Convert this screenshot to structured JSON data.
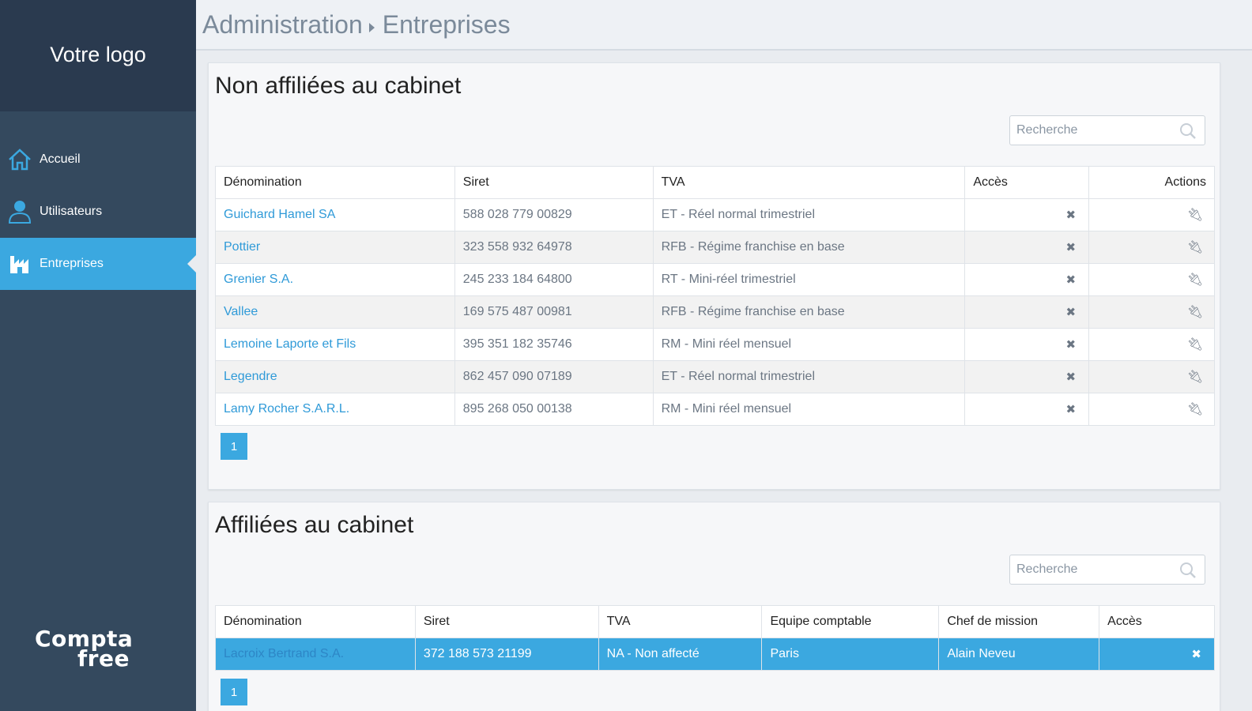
{
  "sidebar": {
    "logo": "Votre logo",
    "items": [
      {
        "label": "Accueil",
        "icon": "home-icon"
      },
      {
        "label": "Utilisateurs",
        "icon": "user-icon"
      },
      {
        "label": "Entreprises",
        "icon": "factory-icon",
        "active": true
      }
    ],
    "brand": {
      "line1": "Compta",
      "line2": "free"
    }
  },
  "header": {
    "crumb1": "Administration",
    "crumb2": "Entreprises"
  },
  "panel1": {
    "title": "Non affiliées au cabinet",
    "search_placeholder": "Recherche",
    "columns": [
      "Dénomination",
      "Siret",
      "TVA",
      "Accès",
      "Actions"
    ],
    "rows": [
      {
        "name": "Guichard Hamel SA",
        "siret": "588 028 779 00829",
        "tva": "ET - Réel normal trimestriel"
      },
      {
        "name": "Pottier",
        "siret": "323 558 932 64978",
        "tva": "RFB - Régime franchise en base"
      },
      {
        "name": "Grenier S.A.",
        "siret": "245 233 184 64800",
        "tva": "RT - Mini-réel trimestriel"
      },
      {
        "name": "Vallee",
        "siret": "169 575 487 00981",
        "tva": "RFB - Régime franchise en base"
      },
      {
        "name": "Lemoine Laporte et Fils",
        "siret": "395 351 182 35746",
        "tva": "RM - Mini réel mensuel"
      },
      {
        "name": "Legendre",
        "siret": "862 457 090 07189",
        "tva": "ET - Réel normal trimestriel"
      },
      {
        "name": "Lamy Rocher S.A.R.L.",
        "siret": "895 268 050 00138",
        "tva": "RM - Mini réel mensuel"
      }
    ],
    "page": "1"
  },
  "panel2": {
    "title": "Affiliées au cabinet",
    "search_placeholder": "Recherche",
    "columns": [
      "Dénomination",
      "Siret",
      "TVA",
      "Equipe comptable",
      "Chef de mission",
      "Accès"
    ],
    "rows": [
      {
        "name": "Lacroix Bertrand S.A.",
        "siret": "372 188 573 21199",
        "tva": "NA - Non affecté",
        "equipe": "Paris",
        "chef": "Alain Neveu"
      }
    ],
    "page": "1"
  },
  "colors": {
    "sidebar": "#34495e",
    "logo_bg": "#2a3a4f",
    "accent": "#3ba8e0",
    "link": "#2f9ad8"
  }
}
